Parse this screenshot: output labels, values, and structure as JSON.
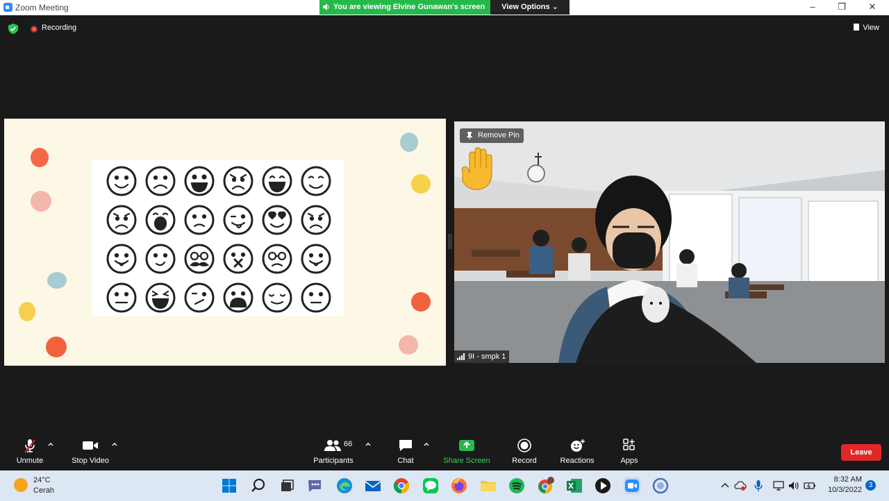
{
  "window": {
    "title": "Zoom Meeting",
    "minimize": "–",
    "maximize": "❐",
    "close": "✕"
  },
  "banner": {
    "viewing": "You are viewing Elvine Gunawan's screen",
    "view_options": "View Options ⌄"
  },
  "topbar": {
    "recording": "Recording",
    "view": "View"
  },
  "video": {
    "remove_pin": "Remove Pin",
    "participant_name": "9I - smpk 1"
  },
  "controls": {
    "unmute": "Unmute",
    "stop_video": "Stop Video",
    "participants": "Participants",
    "participants_count": "66",
    "chat": "Chat",
    "share_screen": "Share Screen",
    "record": "Record",
    "reactions": "Reactions",
    "apps": "Apps",
    "leave": "Leave"
  },
  "colors": {
    "share_green": "#26b94a",
    "leave_red": "#e02828",
    "accent_blue": "#2d8cff"
  },
  "taskbar": {
    "weather_temp": "24°C",
    "weather_condition": "Cerah",
    "time": "8:32 AM",
    "date": "10/3/2022",
    "notifications": "3",
    "icons": [
      "windows-start-icon",
      "search-icon",
      "task-view-icon",
      "teams-chat-icon",
      "edge-icon",
      "mail-icon",
      "chrome-icon",
      "line-icon",
      "firefox-icon",
      "file-explorer-icon",
      "spotify-icon",
      "chrome-profile-icon",
      "excel-icon",
      "media-player-icon",
      "zoom-icon",
      "app-icon"
    ]
  }
}
